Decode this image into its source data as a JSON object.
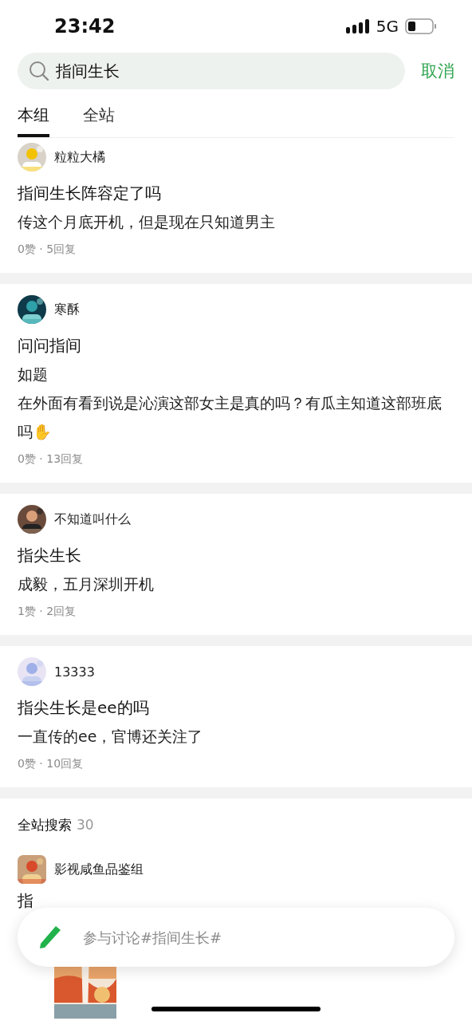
{
  "status_bar": {
    "time": "23:42",
    "network": "5G"
  },
  "search": {
    "value": "指间生长",
    "cancel": "取消"
  },
  "tabs": [
    {
      "label": "本组",
      "selected": true
    },
    {
      "label": "全站",
      "selected": false
    }
  ],
  "posts": [
    {
      "author": "粒粒大橘",
      "avatar": {
        "kind": "picture"
      },
      "title": "指间生长阵容定了吗",
      "lines": [
        "传这个月底开机，但是现在只知道男主"
      ],
      "meta": "0赞 · 5回复"
    },
    {
      "author": "寒酥",
      "avatar": {
        "kind": "picture"
      },
      "title": "问问指间",
      "lines": [
        "如题",
        "在外面有看到说是沁演这部女主是真的吗？有瓜主知道这部班底吗✋"
      ],
      "meta": "0赞 · 13回复"
    },
    {
      "author": "不知道叫什么",
      "avatar": {
        "kind": "picture"
      },
      "title": "指尖生长",
      "lines": [
        "成毅，五月深圳开机"
      ],
      "meta": "1赞 · 2回复"
    },
    {
      "author": "13333",
      "avatar": {
        "kind": "picture"
      },
      "title": "指尖生长是ee的吗",
      "lines": [
        "一直传的ee，官博还关注了"
      ],
      "meta": "0赞 · 10回复"
    }
  ],
  "global_search": {
    "title": "全站搜索",
    "count": "30",
    "results": [
      {
        "group": "影视咸鱼品鉴组",
        "avatar": {
          "kind": "picture"
        },
        "title": "指",
        "thumbnail": {
          "kind": "picture"
        }
      }
    ]
  },
  "compose": {
    "placeholder": "参与讨论#指间生长#"
  }
}
